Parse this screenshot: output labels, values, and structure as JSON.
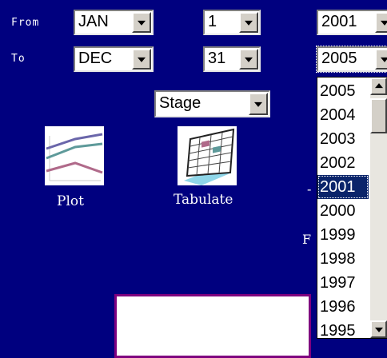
{
  "from": {
    "label": "From",
    "month": "JAN",
    "day": "1",
    "year": "2001"
  },
  "to": {
    "label": "To",
    "month": "DEC",
    "day": "31",
    "year": "2005"
  },
  "group_by": "Stage",
  "actions": {
    "plot_label": "Plot",
    "tabulate_label": "Tabulate"
  },
  "year_dropdown": {
    "options": [
      "2005",
      "2004",
      "2003",
      "2002",
      "2001",
      "2000",
      "1999",
      "1998",
      "1997",
      "1996",
      "1995"
    ],
    "highlighted": "2001"
  },
  "partial_text": {
    "dash": "-",
    "f": "F"
  },
  "colors": {
    "background": "#00007f",
    "highlight": "#0a246a",
    "panel_border": "#7f007f"
  }
}
